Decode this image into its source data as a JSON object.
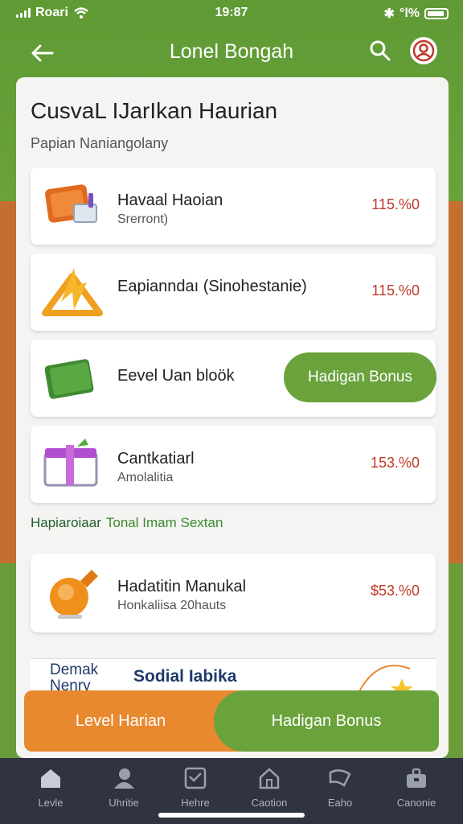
{
  "status_bar": {
    "carrier": "Roari",
    "time": "19:87",
    "battery_text": "°l%"
  },
  "header": {
    "title": "Lonel Bongah"
  },
  "card": {
    "title": "CusvaL IJarIkan Haurian",
    "subtitle": "Papian Naniangolany"
  },
  "items": [
    {
      "title": "Havaal Haoian",
      "subtitle": "Srerront)",
      "value": "115.%0",
      "icon": "wallet-tools-icon"
    },
    {
      "title": "Eapianndaı (Sinohestanie)",
      "subtitle": "",
      "value": "115.%0",
      "icon": "arrow-triangle-icon"
    },
    {
      "title": "Eevel Uan bloök",
      "subtitle": "",
      "button_label": "Hadigan Bonus",
      "icon": "green-book-icon"
    },
    {
      "title": "Cantkatiarl",
      "subtitle": "Amolalitia",
      "value": "153.%0",
      "icon": "gift-box-icon"
    }
  ],
  "section_label": {
    "part1": "Hapiaroiaar",
    "part2": "Tonal Imam Sextan"
  },
  "featured_item": {
    "title": "Hadatitin Manukal",
    "subtitle": "Honkaliisa 20hauts",
    "value": "$53.%0",
    "icon": "orange-bell-icon"
  },
  "cutoff_row": {
    "left_line1": "Demak",
    "left_line2": "Nenry",
    "middle": "Sodial Iabika"
  },
  "bottom_actions": {
    "level_label": "Level Harian",
    "bonus_label": "Hadigan Bonus"
  },
  "tabs": [
    {
      "label": "Levle",
      "icon": "home-icon"
    },
    {
      "label": "Uhritie",
      "icon": "person-icon"
    },
    {
      "label": "Hehre",
      "icon": "inbox-icon"
    },
    {
      "label": "Caotion",
      "icon": "house-outline-icon"
    },
    {
      "label": "Eaho",
      "icon": "flag-icon"
    },
    {
      "label": "Canonie",
      "icon": "briefcase-icon"
    }
  ],
  "colors": {
    "brand_green": "#6aa23b",
    "accent_orange": "#e8892f",
    "value_red": "#c0392b",
    "tab_bar": "#2f3440"
  }
}
